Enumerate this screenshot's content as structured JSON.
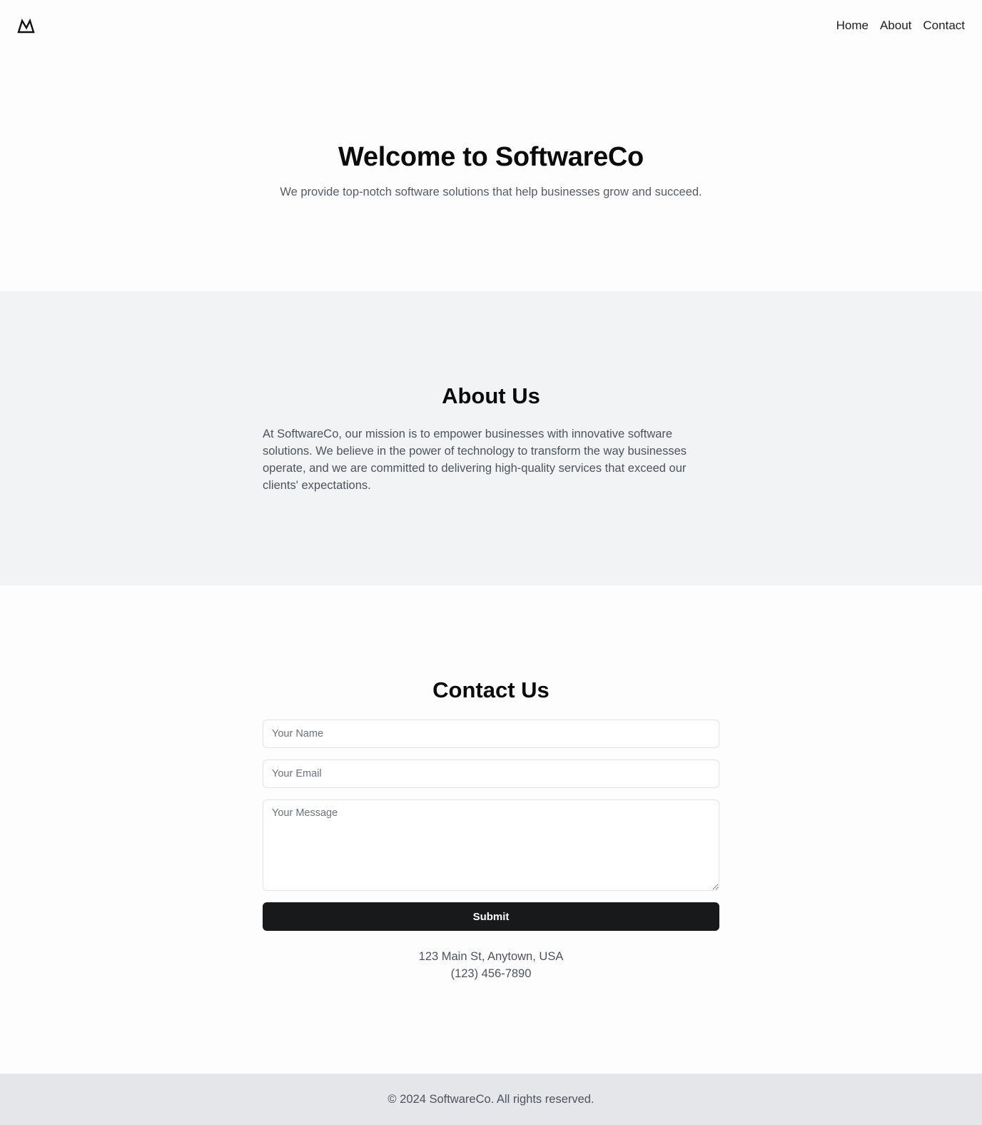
{
  "header": {
    "logo_icon": "mountain-icon",
    "nav": [
      {
        "label": "Home"
      },
      {
        "label": "About"
      },
      {
        "label": "Contact"
      }
    ]
  },
  "hero": {
    "title": "Welcome to SoftwareCo",
    "subtitle": "We provide top-notch software solutions that help businesses grow and succeed."
  },
  "about": {
    "title": "About Us",
    "text": "At SoftwareCo, our mission is to empower businesses with innovative software solutions. We believe in the power of technology to transform the way businesses operate, and we are committed to delivering high-quality services that exceed our clients' expectations."
  },
  "contact": {
    "title": "Contact Us",
    "name_placeholder": "Your Name",
    "email_placeholder": "Your Email",
    "message_placeholder": "Your Message",
    "submit_label": "Submit",
    "address": "123 Main St, Anytown, USA",
    "phone": "(123) 456-7890"
  },
  "footer": {
    "text": "© 2024 SoftwareCo. All rights reserved."
  },
  "colors": {
    "page_background": "#fdfdfd",
    "about_background": "#f2f3f5",
    "footer_background": "#e5e6e9",
    "button_background": "#18191b",
    "body_text": "#4d535d"
  }
}
